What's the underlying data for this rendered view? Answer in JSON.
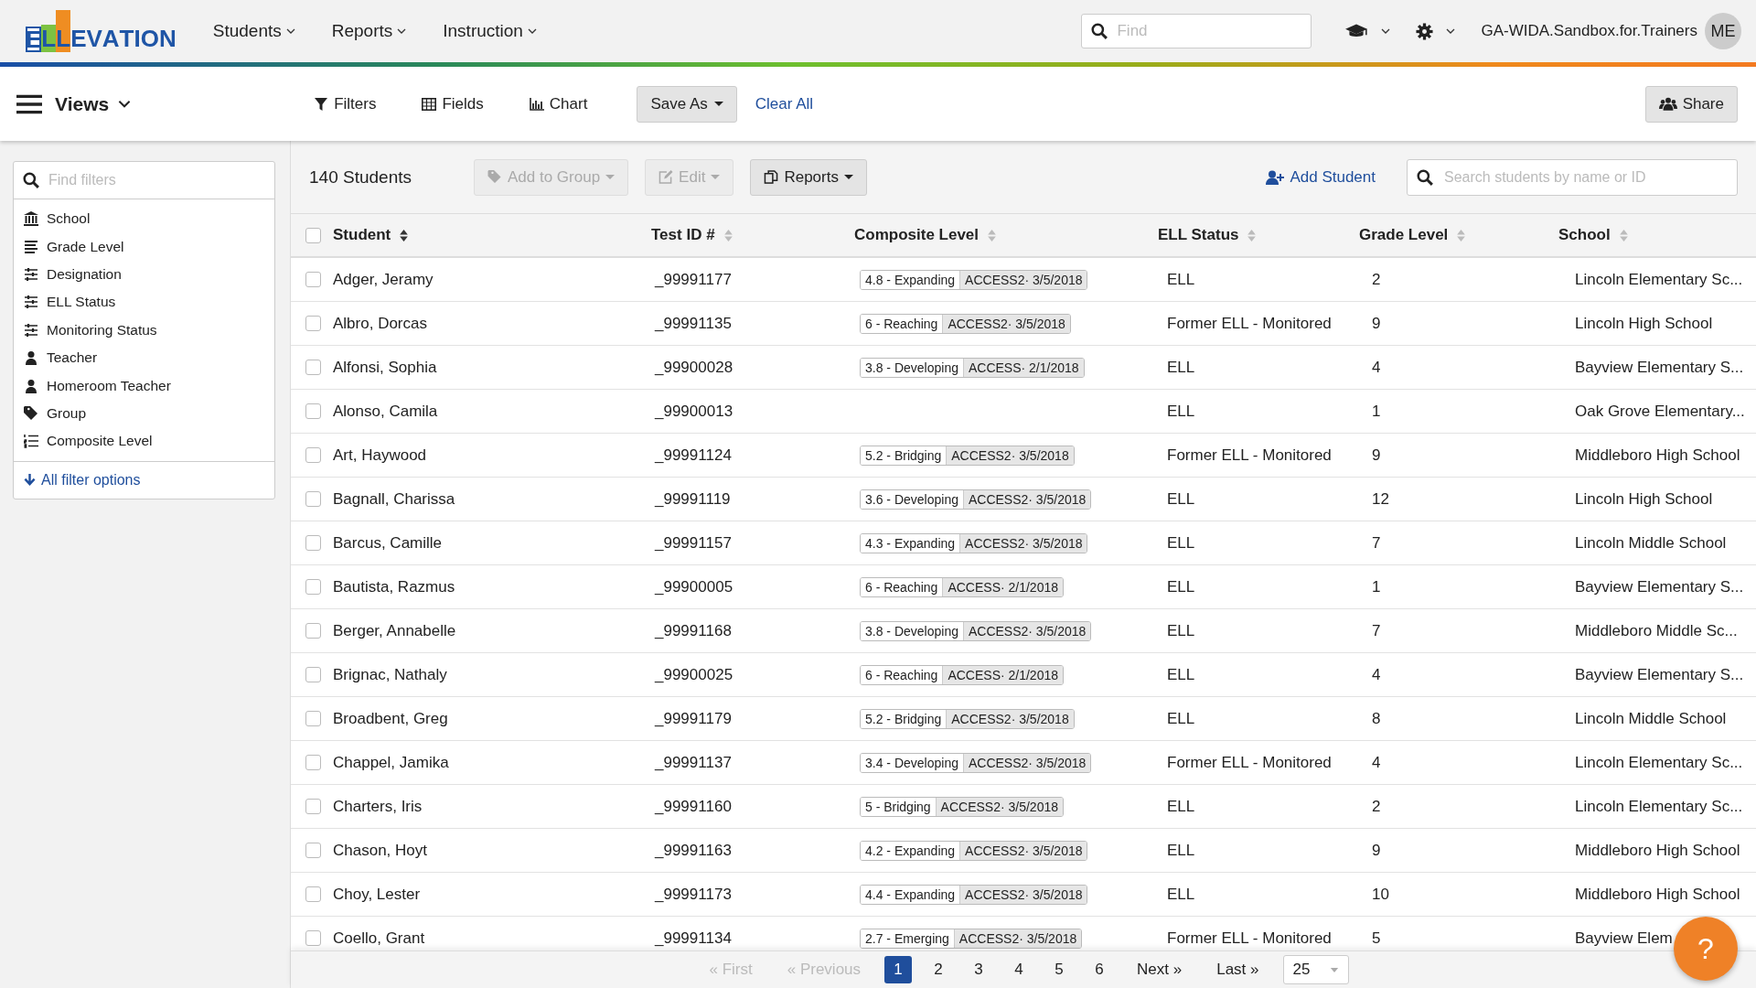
{
  "header": {
    "logo": "ELLEVATION",
    "nav": [
      {
        "label": "Students"
      },
      {
        "label": "Reports"
      },
      {
        "label": "Instruction"
      }
    ],
    "search": {
      "placeholder": "Find"
    },
    "account": "GA-WIDA.Sandbox.for.Trainers",
    "avatar": "ME"
  },
  "toolbar": {
    "views": "Views",
    "actions": [
      {
        "label": "Filters",
        "kind": "filter"
      },
      {
        "label": "Fields",
        "kind": "table"
      },
      {
        "label": "Chart",
        "kind": "chart"
      }
    ],
    "save_as": "Save As",
    "clear_all": "Clear All",
    "share": "Share"
  },
  "sidebar": {
    "search": {
      "placeholder": "Find filters"
    },
    "items": [
      {
        "label": "School",
        "kind": "building"
      },
      {
        "label": "Grade Level",
        "kind": "lines"
      },
      {
        "label": "Designation",
        "kind": "sliders"
      },
      {
        "label": "ELL Status",
        "kind": "sliders"
      },
      {
        "label": "Monitoring Status",
        "kind": "sliders"
      },
      {
        "label": "Teacher",
        "kind": "person"
      },
      {
        "label": "Homeroom Teacher",
        "kind": "person"
      },
      {
        "label": "Group",
        "kind": "tag"
      },
      {
        "label": "Composite Level",
        "kind": "numbered"
      }
    ],
    "more": "All filter options"
  },
  "list": {
    "count": "140 Students",
    "buttons": [
      {
        "label": "Add to Group",
        "kind": "tag",
        "disabled": true
      },
      {
        "label": "Edit",
        "kind": "edit",
        "disabled": true
      },
      {
        "label": "Reports",
        "kind": "copy",
        "disabled": false
      }
    ],
    "add_student": "Add Student",
    "search": {
      "placeholder": "Search students by name or ID"
    }
  },
  "table": {
    "select_all": {
      "checked": false
    },
    "columns": [
      {
        "label": "Student",
        "sorted": true
      },
      {
        "label": "Test ID #",
        "sorted": false
      },
      {
        "label": "Composite Level",
        "sorted": false
      },
      {
        "label": "ELL Status",
        "sorted": false
      },
      {
        "label": "Grade Level",
        "sorted": false
      },
      {
        "label": "School",
        "sorted": false
      }
    ],
    "rows": [
      {
        "checked": false,
        "student": "Adger, Jeramy",
        "test_id": "_99991177",
        "score": "4.8 - Expanding",
        "assessment": "ACCESS2· 3/5/2018",
        "ell_status": "ELL",
        "grade": "2",
        "school": "Lincoln Elementary Sc..."
      },
      {
        "checked": false,
        "student": "Albro, Dorcas",
        "test_id": "_99991135",
        "score": "6 - Reaching",
        "assessment": "ACCESS2· 3/5/2018",
        "ell_status": "Former ELL - Monitored",
        "grade": "9",
        "school": "Lincoln High School"
      },
      {
        "checked": false,
        "student": "Alfonsi, Sophia",
        "test_id": "_99900028",
        "score": "3.8 - Developing",
        "assessment": "ACCESS· 2/1/2018",
        "ell_status": "ELL",
        "grade": "4",
        "school": "Bayview Elementary S..."
      },
      {
        "checked": false,
        "student": "Alonso, Camila",
        "test_id": "_99900013",
        "ell_status": "ELL",
        "grade": "1",
        "school": "Oak Grove Elementary..."
      },
      {
        "checked": false,
        "student": "Art, Haywood",
        "test_id": "_99991124",
        "score": "5.2 - Bridging",
        "assessment": "ACCESS2· 3/5/2018",
        "ell_status": "Former ELL - Monitored",
        "grade": "9",
        "school": "Middleboro High School"
      },
      {
        "checked": false,
        "student": "Bagnall, Charissa",
        "test_id": "_99991119",
        "score": "3.6 - Developing",
        "assessment": "ACCESS2· 3/5/2018",
        "ell_status": "ELL",
        "grade": "12",
        "school": "Lincoln High School"
      },
      {
        "checked": false,
        "student": "Barcus, Camille",
        "test_id": "_99991157",
        "score": "4.3 - Expanding",
        "assessment": "ACCESS2· 3/5/2018",
        "ell_status": "ELL",
        "grade": "7",
        "school": "Lincoln Middle School"
      },
      {
        "checked": false,
        "student": "Bautista, Razmus",
        "test_id": "_99900005",
        "score": "6 - Reaching",
        "assessment": "ACCESS· 2/1/2018",
        "ell_status": "ELL",
        "grade": "1",
        "school": "Bayview Elementary S..."
      },
      {
        "checked": false,
        "student": "Berger, Annabelle",
        "test_id": "_99991168",
        "score": "3.8 - Developing",
        "assessment": "ACCESS2· 3/5/2018",
        "ell_status": "ELL",
        "grade": "7",
        "school": "Middleboro Middle Sc..."
      },
      {
        "checked": false,
        "student": "Brignac, Nathaly",
        "test_id": "_99900025",
        "score": "6 - Reaching",
        "assessment": "ACCESS· 2/1/2018",
        "ell_status": "ELL",
        "grade": "4",
        "school": "Bayview Elementary S..."
      },
      {
        "checked": false,
        "student": "Broadbent, Greg",
        "test_id": "_99991179",
        "score": "5.2 - Bridging",
        "assessment": "ACCESS2· 3/5/2018",
        "ell_status": "ELL",
        "grade": "8",
        "school": "Lincoln Middle School"
      },
      {
        "checked": false,
        "student": "Chappel, Jamika",
        "test_id": "_99991137",
        "score": "3.4 - Developing",
        "assessment": "ACCESS2· 3/5/2018",
        "ell_status": "Former ELL - Monitored",
        "grade": "4",
        "school": "Lincoln Elementary Sc..."
      },
      {
        "checked": false,
        "student": "Charters, Iris",
        "test_id": "_99991160",
        "score": "5 - Bridging",
        "assessment": "ACCESS2· 3/5/2018",
        "ell_status": "ELL",
        "grade": "2",
        "school": "Lincoln Elementary Sc..."
      },
      {
        "checked": false,
        "student": "Chason, Hoyt",
        "test_id": "_99991163",
        "score": "4.2 - Expanding",
        "assessment": "ACCESS2· 3/5/2018",
        "ell_status": "ELL",
        "grade": "9",
        "school": "Middleboro High School"
      },
      {
        "checked": false,
        "student": "Choy, Lester",
        "test_id": "_99991173",
        "score": "4.4 - Expanding",
        "assessment": "ACCESS2· 3/5/2018",
        "ell_status": "ELL",
        "grade": "10",
        "school": "Middleboro High School"
      },
      {
        "checked": false,
        "student": "Coello, Grant",
        "test_id": "_99991134",
        "score": "2.7 - Emerging",
        "assessment": "ACCESS2· 3/5/2018",
        "ell_status": "Former ELL - Monitored",
        "grade": "5",
        "school": "Bayview Elem"
      }
    ]
  },
  "pagination": {
    "first": {
      "label": "« First",
      "disabled": true
    },
    "previous": {
      "label": "« Previous",
      "disabled": true
    },
    "pages": [
      {
        "label": "1",
        "selected": true
      },
      {
        "label": "2",
        "selected": false
      },
      {
        "label": "3",
        "selected": false
      },
      {
        "label": "4",
        "selected": false
      },
      {
        "label": "5",
        "selected": false
      },
      {
        "label": "6",
        "selected": false
      }
    ],
    "next": {
      "label": "Next »",
      "disabled": false
    },
    "last": {
      "label": "Last »",
      "disabled": false
    },
    "page_size": "25"
  },
  "help": "?"
}
